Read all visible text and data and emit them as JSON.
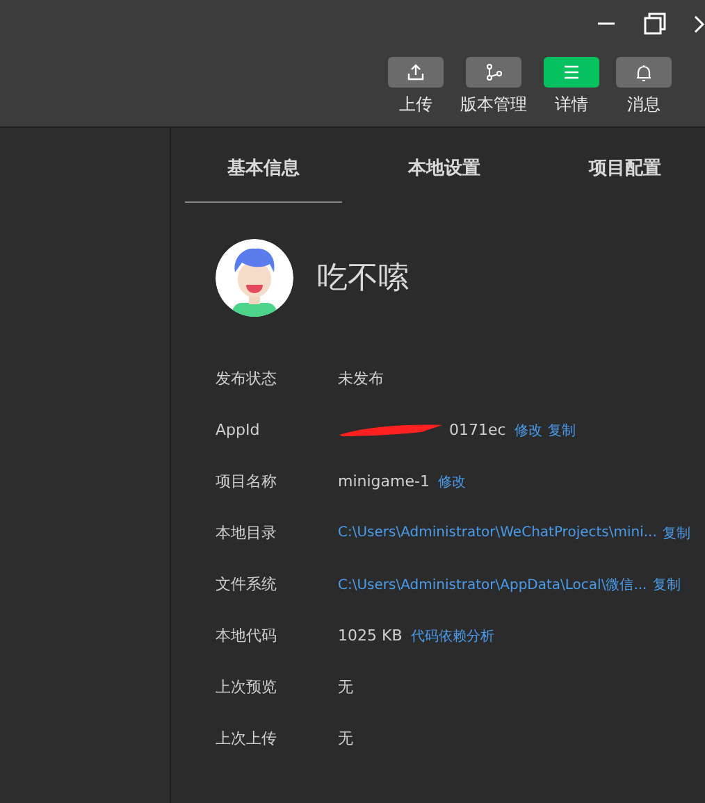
{
  "toolbar": [
    {
      "label": "上传",
      "selected": false
    },
    {
      "label": "版本管理",
      "selected": false
    },
    {
      "label": "详情",
      "selected": true
    },
    {
      "label": "消息",
      "selected": false
    }
  ],
  "tabs": [
    {
      "label": "基本信息",
      "selected": true
    },
    {
      "label": "本地设置",
      "selected": false
    },
    {
      "label": "项目配置",
      "selected": false
    }
  ],
  "project": {
    "name": "吃不嗦"
  },
  "rows": [
    {
      "label": "发布状态",
      "redacted": false,
      "parts": [
        {
          "text": "未发布",
          "kind": "text"
        }
      ]
    },
    {
      "label": "AppId",
      "redacted": true,
      "parts": [
        {
          "text": "0171ec",
          "kind": "text"
        },
        {
          "text": "修改",
          "kind": "link"
        },
        {
          "text": "复制",
          "kind": "link"
        }
      ]
    },
    {
      "label": "项目名称",
      "redacted": false,
      "parts": [
        {
          "text": "minigame-1",
          "kind": "text"
        },
        {
          "text": "修改",
          "kind": "link"
        }
      ]
    },
    {
      "label": "本地目录",
      "redacted": false,
      "parts": [
        {
          "text": "C:\\Users\\Administrator\\WeChatProjects\\mini...",
          "kind": "link"
        },
        {
          "text": "复制",
          "kind": "link"
        }
      ]
    },
    {
      "label": "文件系统",
      "redacted": false,
      "parts": [
        {
          "text": "C:\\Users\\Administrator\\AppData\\Local\\微信...",
          "kind": "link"
        },
        {
          "text": "复制",
          "kind": "link"
        }
      ]
    },
    {
      "label": "本地代码",
      "redacted": false,
      "parts": [
        {
          "text": "1025 KB",
          "kind": "text"
        },
        {
          "text": "代码依赖分析",
          "kind": "link"
        }
      ]
    },
    {
      "label": "上次预览",
      "redacted": false,
      "parts": [
        {
          "text": "无",
          "kind": "text"
        }
      ]
    },
    {
      "label": "上次上传",
      "redacted": false,
      "parts": [
        {
          "text": "无",
          "kind": "text"
        }
      ]
    }
  ]
}
